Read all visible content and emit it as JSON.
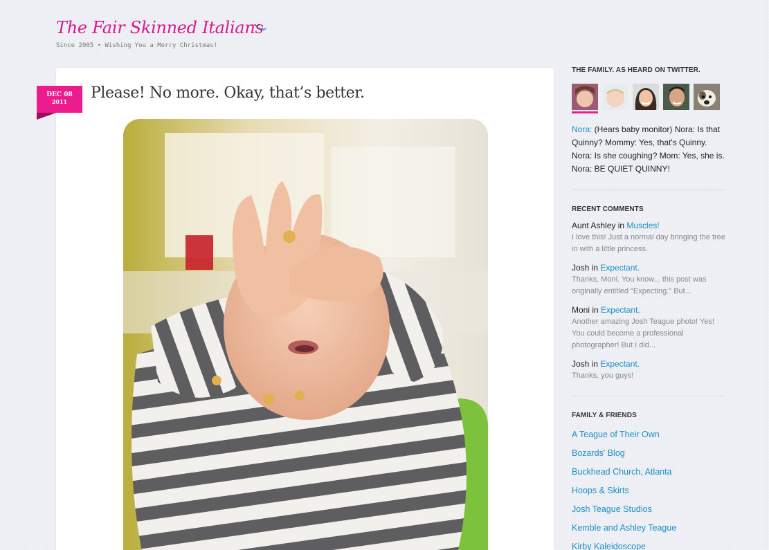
{
  "header": {
    "title": "The Fair Skinned Italians",
    "tagline": "Since 2005 • Wishing You a Merry Christmas!"
  },
  "post": {
    "date_month_day": "DEC 08",
    "date_year": "2011",
    "title": "Please! No more. Okay, that’s better."
  },
  "sidebar": {
    "twitter": {
      "title": "THE FAMILY. AS HEARD ON TWITTER.",
      "tweet_user": "Nora:",
      "tweet_text": " (Hears baby monitor) Nora: Is that Quinny? Mommy: Yes, that's Quinny. Nora: Is she coughing? Mom: Yes, she is. Nora: BE QUIET QUINNY!"
    },
    "recent_comments": {
      "title": "RECENT COMMENTS",
      "items": [
        {
          "author": "Aunt Ashley",
          "in": " in ",
          "post": "Muscles!",
          "excerpt": "I love this! Just a normal day bringing the tree in with a little princess."
        },
        {
          "author": "Josh",
          "in": " in ",
          "post": "Expectant.",
          "excerpt": "Thanks, Moni. You know... this post was originally entitled \"Expecting.\" But..."
        },
        {
          "author": "Moni",
          "in": " in ",
          "post": "Expectant.",
          "excerpt": "Another amazing Josh Teague photo! Yes! You could become a professional photographer! But I did..."
        },
        {
          "author": "Josh",
          "in": " in ",
          "post": "Expectant.",
          "excerpt": "Thanks, you guys!"
        }
      ]
    },
    "friends": {
      "title": "FAMILY & FRIENDS",
      "links": [
        "A Teague of Their Own",
        "Bozards' Blog",
        "Buckhead Church, Atlanta",
        "Hoops & Skirts",
        "Josh Teague Studios",
        "Kemble and Ashley Teague",
        "Kirby Kaleidoscope"
      ]
    }
  }
}
